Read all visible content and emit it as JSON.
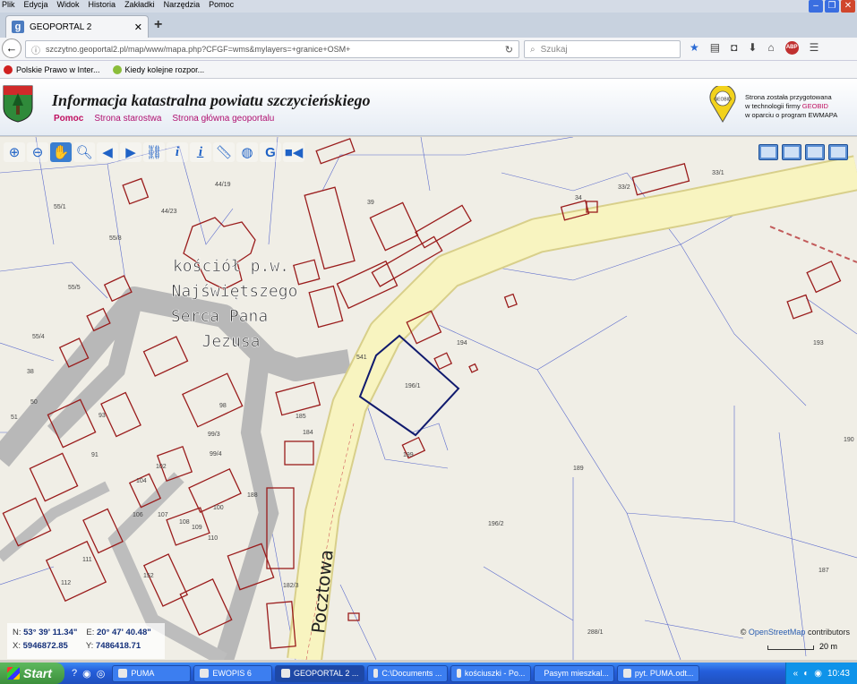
{
  "browser": {
    "menu": [
      "Plik",
      "Edycja",
      "Widok",
      "Historia",
      "Zakładki",
      "Narzędzia",
      "Pomoc"
    ],
    "tab_title": "GEOPORTAL 2",
    "tab_favicon": "g",
    "url": "szczytno.geoportal2.pl/map/www/mapa.php?CFGF=wms&mylayers=+granice+OSM+",
    "search_placeholder": "Szukaj",
    "bookmarks": [
      "Polskie Prawo w Inter...",
      "Kiedy kolejne rozpor..."
    ]
  },
  "header": {
    "title": "Informacja katastralna powiatu szczycieńskiego",
    "links": [
      "Pomoc",
      "Strona starostwa",
      "Strona główna geoportalu"
    ],
    "geobid_lines": [
      "Strona została przygotowana",
      "w technologii firmy",
      "GEOBID",
      "w oparciu o program EWMAPA"
    ],
    "geobid_logo_text": "GEOBID"
  },
  "map": {
    "street_label": "Pocztowa",
    "poi_label_lines": [
      "kościół p.w.",
      "Najświętszego",
      "Serca Pana",
      "Jezusa"
    ],
    "parcel_numbers": [
      "55/1",
      "44/19",
      "44/23",
      "55/8",
      "55/5",
      "55/4",
      "39",
      "34",
      "33/2",
      "33/1",
      "541",
      "196/1",
      "194",
      "193",
      "190",
      "189",
      "196/2",
      "187",
      "288/1",
      "185",
      "184",
      "91",
      "93",
      "99/3",
      "99/4",
      "98",
      "100",
      "102",
      "104",
      "106",
      "107",
      "108",
      "109",
      "110",
      "111",
      "112",
      "152",
      "182/3",
      "188",
      "50",
      "51",
      "38",
      "199"
    ],
    "coordinates": {
      "n_label": "N:",
      "n_value": "53° 39' 11.34\"",
      "e_label": "E:",
      "e_value": "20° 47' 40.48\"",
      "x_label": "X:",
      "x_value": "5946872.85",
      "y_label": "Y:",
      "y_value": "7486418.71"
    },
    "attribution_prefix": "©",
    "attribution_link": "OpenStreetMap",
    "attribution_suffix": "contributors",
    "scale_label": "20 m",
    "colors": {
      "road": "#f8f4c0",
      "road_edge": "#d8cf8a",
      "parcel": "#9a1c1c",
      "selected": "#101a6e",
      "plot_line": "#5a6acc"
    }
  },
  "taskbar": {
    "start_label": "Start",
    "items": [
      "PUMA",
      "EWOPIS 6",
      "GEOPORTAL 2 ...",
      "C:\\Documents ...",
      "kościuszki - Po...",
      "Pasym mieszkal...",
      "pyt. PUMA.odt..."
    ],
    "active_index": 2,
    "clock": "10:43"
  }
}
